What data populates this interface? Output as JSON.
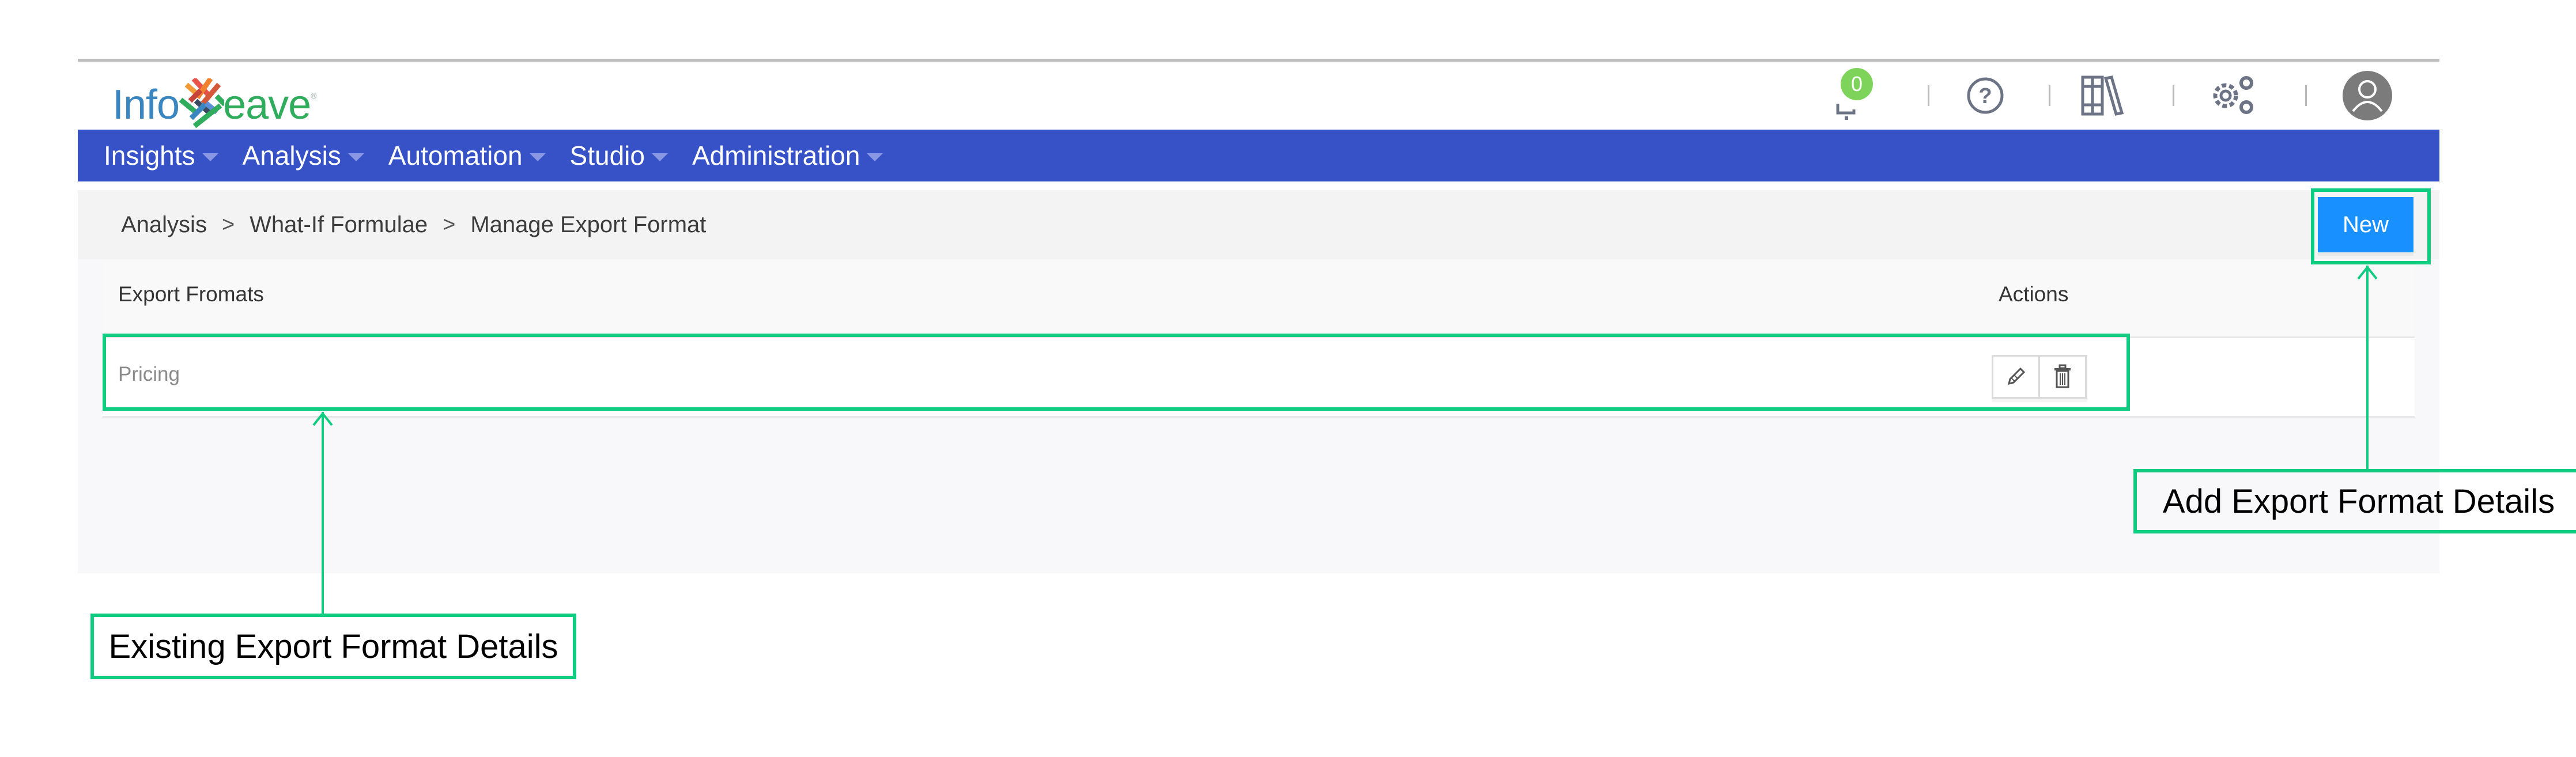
{
  "app": {
    "logo_left": "Info",
    "logo_right": "eave",
    "logo_tm": "®",
    "notification_count": "0"
  },
  "header_icons": [
    {
      "name": "bell-icon",
      "label": "Notifications"
    },
    {
      "name": "help-icon",
      "label": "Help"
    },
    {
      "name": "library-icon",
      "label": "Library"
    },
    {
      "name": "settings-icon",
      "label": "Settings"
    },
    {
      "name": "user-avatar-icon",
      "label": "User"
    }
  ],
  "nav": {
    "items": [
      {
        "label": "Insights"
      },
      {
        "label": "Analysis"
      },
      {
        "label": "Automation"
      },
      {
        "label": "Studio"
      },
      {
        "label": "Administration"
      }
    ]
  },
  "breadcrumb": {
    "items": [
      "Analysis",
      "What-If Formulae",
      "Manage Export Format"
    ],
    "separator": ">"
  },
  "toolbar": {
    "new_label": "New"
  },
  "table": {
    "columns": [
      "Export Fromats",
      "Actions"
    ],
    "rows": [
      {
        "name": "Pricing",
        "actions": [
          "edit",
          "delete"
        ]
      }
    ]
  },
  "annotations": {
    "existing": "Existing Export Format Details",
    "add": "Add Export Format Details"
  },
  "colors": {
    "navbar": "#3751c6",
    "primary_button": "#1890ff",
    "callout": "#10cc80",
    "badge": "#7ed35b"
  }
}
